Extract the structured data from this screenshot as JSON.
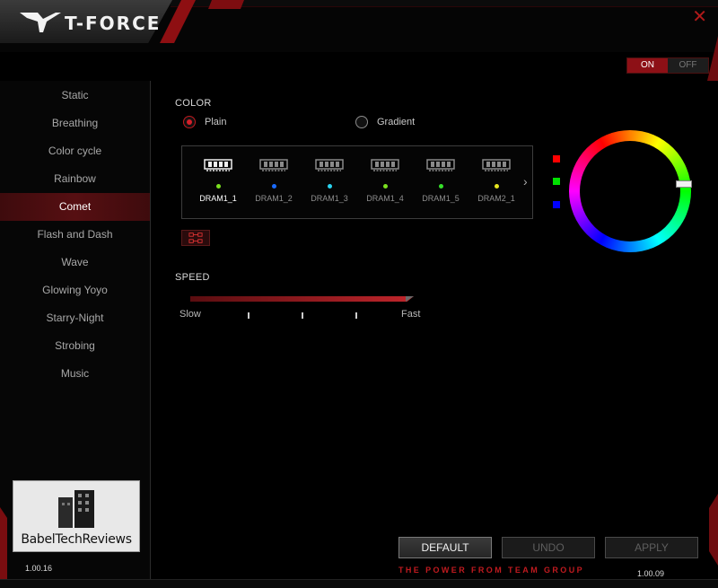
{
  "app": {
    "title": "T-FORCE",
    "close_icon": "close-icon"
  },
  "power_toggle": {
    "on_label": "ON",
    "off_label": "OFF",
    "state": "ON"
  },
  "sidebar": {
    "items": [
      {
        "label": "Static"
      },
      {
        "label": "Breathing"
      },
      {
        "label": "Color cycle"
      },
      {
        "label": "Rainbow"
      },
      {
        "label": "Comet"
      },
      {
        "label": "Flash and Dash"
      },
      {
        "label": "Wave"
      },
      {
        "label": "Glowing Yoyo"
      },
      {
        "label": "Starry-Night"
      },
      {
        "label": "Strobing"
      },
      {
        "label": "Music"
      }
    ],
    "active": "Comet",
    "watermark": "BabelTechReviews",
    "version": "1.00.16"
  },
  "color": {
    "title": "COLOR",
    "mode_plain": "Plain",
    "mode_gradient": "Gradient",
    "selected_mode": "Plain",
    "modules": [
      {
        "label": "DRAM1_1",
        "led": "#7be01f",
        "selected": true
      },
      {
        "label": "DRAM1_2",
        "led": "#1a6bff",
        "selected": false
      },
      {
        "label": "DRAM1_3",
        "led": "#2ad4f0",
        "selected": false
      },
      {
        "label": "DRAM1_4",
        "led": "#7be01f",
        "selected": false
      },
      {
        "label": "DRAM1_5",
        "led": "#36e02a",
        "selected": false
      },
      {
        "label": "DRAM2_1",
        "led": "#e6e61f",
        "selected": false
      }
    ],
    "swatches": [
      "#ff0000",
      "#00e000",
      "#0000ff"
    ],
    "accent": "#c01a1f"
  },
  "speed": {
    "title": "SPEED",
    "slow_label": "Slow",
    "fast_label": "Fast",
    "level": 1.0
  },
  "footer": {
    "default_label": "DEFAULT",
    "undo_label": "UNDO",
    "apply_label": "APPLY",
    "tagline": "THE POWER FROM TEAM GROUP",
    "version": "1.00.09"
  }
}
